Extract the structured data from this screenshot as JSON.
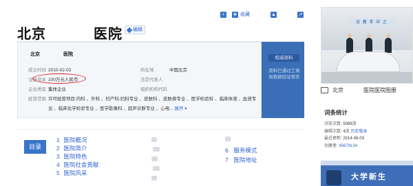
{
  "header": {
    "title_part1": "北京",
    "title_part2": "医院",
    "edit_label": "编辑",
    "actions": {
      "add_icon": "plus-icon",
      "favorite_label": "收藏",
      "like_icon": "thumbs-up-icon",
      "share_icon": "share-icon"
    }
  },
  "card": {
    "name_part1": "北京",
    "name_part2": "医院",
    "rows": [
      {
        "label": "成立时间",
        "value": "2010-02-03",
        "label2": "所在地",
        "value2": "中国北京"
      },
      {
        "label": "注册资本",
        "value": "100万元人民币",
        "label2": "法定代表人",
        "value2": ""
      },
      {
        "label": "企业类型",
        "value": "集体企业",
        "label2": "组织机构代码",
        "value2": ""
      },
      {
        "label": "经营范围",
        "value": "许可经营项目:内科 、外科 、妇产科:妇科专业 、皮肤科 、皮肤病专业 、医学检验科 、临床体液 、血液专",
        "label2": "",
        "value2": ""
      },
      {
        "label": "",
        "value": "业 、临床化学检验专业 、医学影像科 、超声诊断专业 、心电...",
        "label2": "",
        "value2": ""
      }
    ],
    "more_label": "展开",
    "side_badge": "权威资料",
    "side_note": "资料已通过工商局数据验证核实"
  },
  "catalog": {
    "button_label": "目录",
    "left_items": [
      {
        "num": "1",
        "label": "医院概况"
      },
      {
        "num": "2",
        "label": "医院简介"
      },
      {
        "num": "3",
        "label": "医院特色"
      },
      {
        "num": "4",
        "label": "医院社会贡献"
      },
      {
        "num": "5",
        "label": "医院风采"
      }
    ],
    "right_items": [
      {
        "num": "6",
        "label": "服务模式"
      },
      {
        "num": "7",
        "label": "医院地址"
      }
    ]
  },
  "photo": {
    "sign_text": "日 教 手 中 之",
    "caption_name_part1": "北京",
    "caption_name_part2": "医院",
    "gallery_label": "医院图册",
    "image_icon": "image-icon"
  },
  "stats": {
    "title": "词条统计",
    "views_label": "浏览次数:",
    "views_value": "5089次",
    "edits_label": "编辑次数:",
    "edits_value": "4次",
    "history_link": "历史版本",
    "updated_label": "最近更新:",
    "updated_value": "2014-06-03",
    "creator_label": "创建者:",
    "creator_value": "45678134"
  },
  "banner": {
    "text": "大学新生"
  },
  "colors": {
    "accent": "#3a74c9",
    "link": "#3366cc",
    "side_tag": "#3a6fb8",
    "highlight_circle": "#dd2222"
  }
}
